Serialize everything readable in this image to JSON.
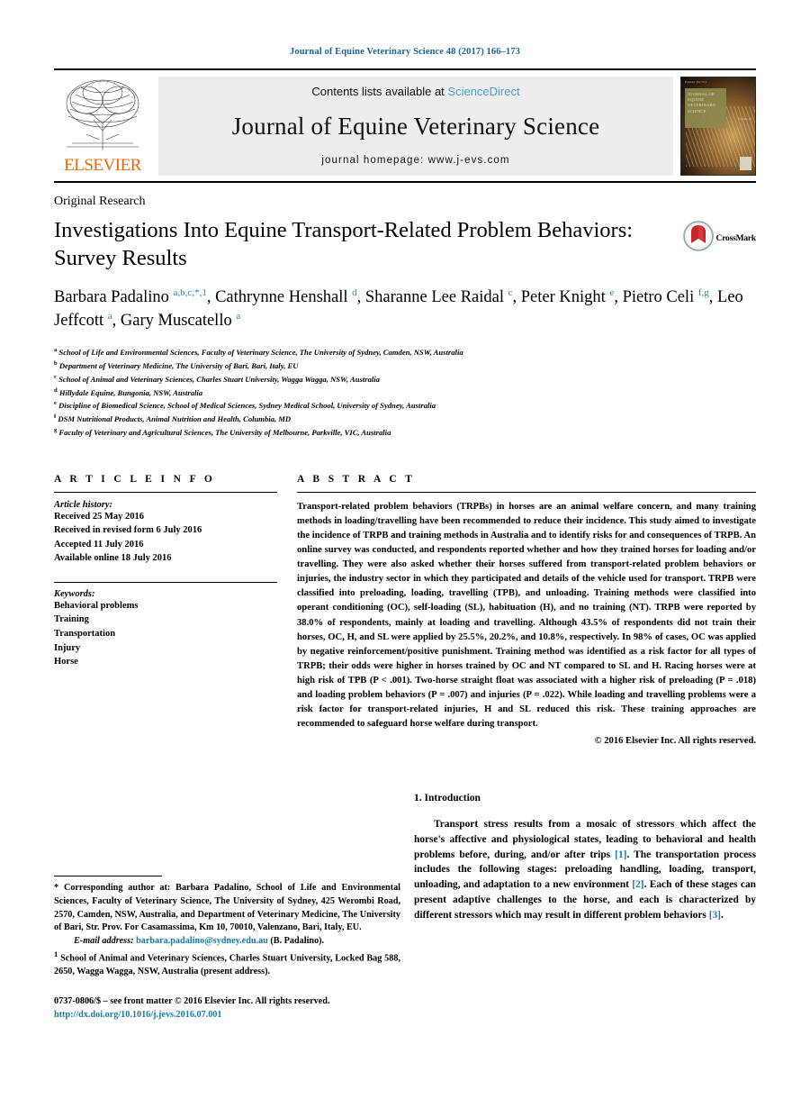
{
  "running_head": "Journal of Equine Veterinary Science 48 (2017) 166–173",
  "masthead": {
    "contents_prefix": "Contents lists available at ",
    "sciencedirect": "ScienceDirect",
    "journal_name": "Journal of Equine Veterinary Science",
    "homepage": "journal homepage: www.j-evs.com",
    "publisher": "ELSEVIER",
    "cover_title": "JOURNAL OF EQUINE VETERINARY SCIENCE"
  },
  "article": {
    "type": "Original Research",
    "title": "Investigations Into Equine Transport-Related Problem Behaviors: Survey Results",
    "crossmark_label": "CrossMark",
    "authors_html": "Barbara Padalino <sup>a,b,c,</sup><sup class=\"star\">*,1</sup>, Cathrynne Henshall <sup>d</sup>, Sharanne Lee Raidal <sup>c</sup>, Peter Knight <sup>e</sup>, Pietro Celi <sup>f,g</sup>, Leo Jeffcott <sup>a</sup>, Gary Muscatello <sup>a</sup>",
    "affiliations": [
      {
        "mark": "a",
        "text": "School of Life and Environmental Sciences, Faculty of Veterinary Science, The University of Sydney, Camden, NSW, Australia"
      },
      {
        "mark": "b",
        "text": "Department of Veterinary Medicine, The University of Bari, Bari, Italy, EU"
      },
      {
        "mark": "c",
        "text": "School of Animal and Veterinary Sciences, Charles Stuart University, Wagga Wagga, NSW, Australia"
      },
      {
        "mark": "d",
        "text": "Hillydale Equine, Bungonia, NSW, Australia"
      },
      {
        "mark": "e",
        "text": "Discipline of Biomedical Science, School of Medical Sciences, Sydney Medical School, University of Sydney, Australia"
      },
      {
        "mark": "f",
        "text": "DSM Nutritional Products, Animal Nutrition and Health, Columbia, MD"
      },
      {
        "mark": "g",
        "text": "Faculty of Veterinary and Agricultural Sciences, The University of Melbourne, Parkville, VIC, Australia"
      }
    ]
  },
  "article_info": {
    "heading": "A R T I C L E  I N F O",
    "history_label": "Article history:",
    "history": [
      "Received 25 May 2016",
      "Received in revised form 6 July 2016",
      "Accepted 11 July 2016",
      "Available online 18 July 2016"
    ],
    "keywords_label": "Keywords:",
    "keywords": [
      "Behavioral problems",
      "Training",
      "Transportation",
      "Injury",
      "Horse"
    ]
  },
  "abstract": {
    "heading": "A B S T R A C T",
    "body": "Transport-related problem behaviors (TRPBs) in horses are an animal welfare concern, and many training methods in loading/travelling have been recommended to reduce their incidence. This study aimed to investigate the incidence of TRPB and training methods in Australia and to identify risks for and consequences of TRPB. An online survey was conducted, and respondents reported whether and how they trained horses for loading and/or travelling. They were also asked whether their horses suffered from transport-related problem behaviors or injuries, the industry sector in which they participated and details of the vehicle used for transport. TRPB were classified into preloading, loading, travelling (TPB), and unloading. Training methods were classified into operant conditioning (OC), self-loading (SL), habituation (H), and no training (NT). TRPB were reported by 38.0% of respondents, mainly at loading and travelling. Although 43.5% of respondents did not train their horses, OC, H, and SL were applied by 25.5%, 20.2%, and 10.8%, respectively. In 98% of cases, OC was applied by negative reinforcement/positive punishment. Training method was identified as a risk factor for all types of TRPB; their odds were higher in horses trained by OC and NT compared to SL and H. Racing horses were at high risk of TPB (P < .001). Two-horse straight float was associated with a higher risk of preloading (P = .018) and loading problem behaviors (P = .007) and injuries (P = .022). While loading and travelling problems were a risk factor for transport-related injuries, H and SL reduced this risk. These training approaches are recommended to safeguard horse welfare during transport.",
    "copyright": "© 2016 Elsevier Inc. All rights reserved."
  },
  "introduction": {
    "heading": "1.  Introduction",
    "paragraph_parts": [
      "Transport stress results from a mosaic of stressors which affect the horse's affective and physiological states, leading to behavioral and health problems before, during, and/or after trips ",
      "[1]",
      ". The transportation process includes the following stages: preloading handling, loading, transport, unloading, and adaptation to a new environment ",
      "[2]",
      ". Each of these stages can present adaptive challenges to the horse, and each is characterized by different stressors which may result in different problem behaviors ",
      "[3]",
      "."
    ]
  },
  "footnotes": {
    "corresponding": "* Corresponding author at: Barbara Padalino, School of Life and Environmental Sciences, Faculty of Veterinary Science, The University of Sydney, 425 Werombi Road, 2570, Camden, NSW, Australia, and Department of Veterinary Medicine, The University of Bari, Str. Prov. For Casamassima, Km 10, 70010, Valenzano, Bari, Italy, EU.",
    "email_label": "E-mail address:",
    "email": "barbara.padalino@sydney.edu.au",
    "email_suffix": "(B. Padalino).",
    "present_address_mark": "1",
    "present_address": "School of Animal and Veterinary Sciences, Charles Stuart University, Locked Bag 588, 2650, Wagga Wagga, NSW, Australia (present address).",
    "issn_line": "0737-0806/$ – see front matter © 2016 Elsevier Inc. All rights reserved.",
    "doi": "http://dx.doi.org/10.1016/j.jevs.2016.07.001"
  },
  "colors": {
    "link": "#1a7ba8",
    "running_head": "#1a6496",
    "sciencedirect": "#4a9fd4",
    "elsevier_orange": "#ec6608",
    "superscript_blue": "#2b7fb8"
  }
}
